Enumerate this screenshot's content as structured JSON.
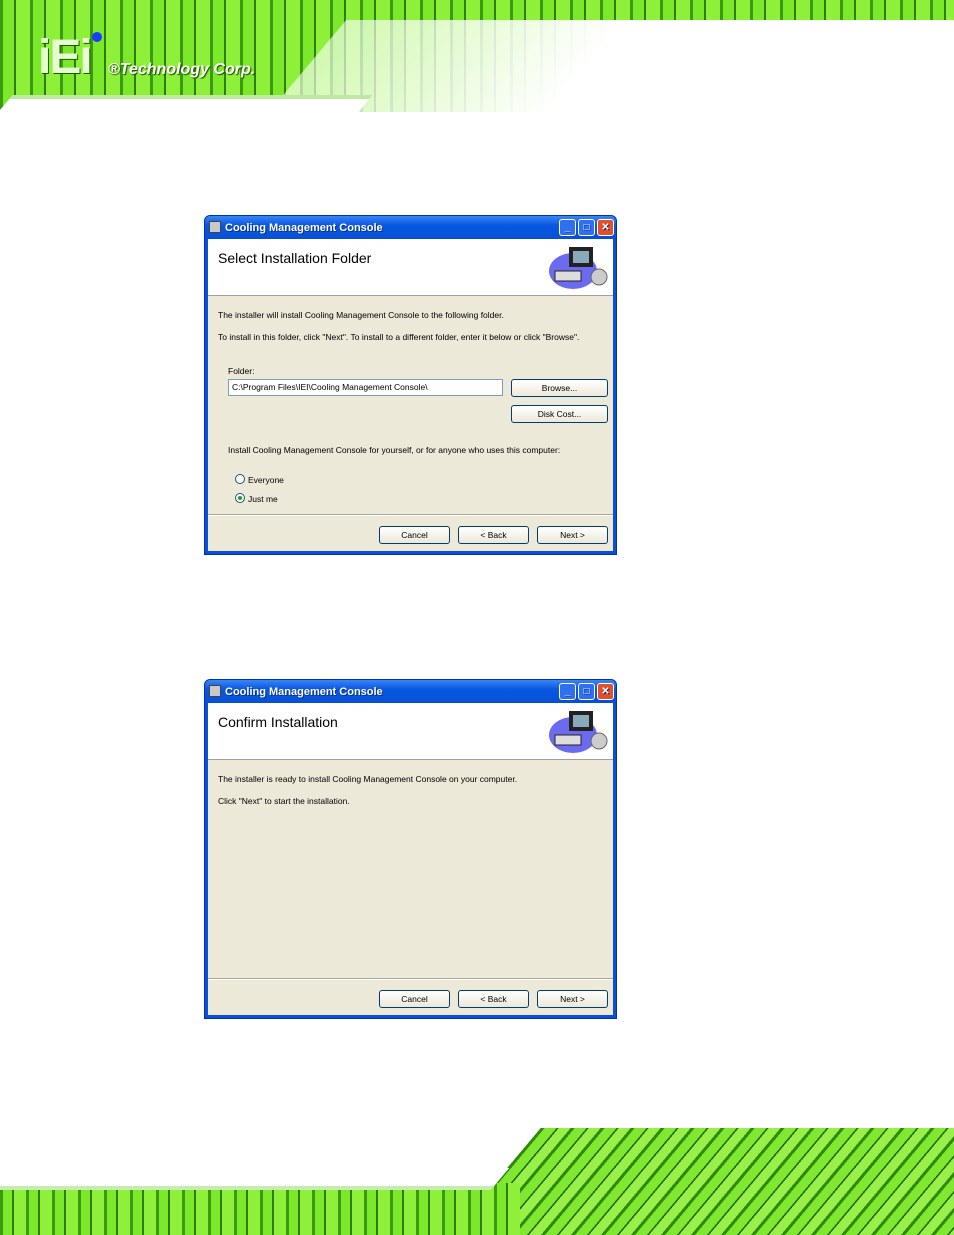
{
  "brand": {
    "logo": "iEi",
    "corp": "®Technology Corp."
  },
  "dialogs": [
    {
      "title": "Cooling Management Console",
      "heading": "Select Installation Folder",
      "line1": "The installer will install Cooling Management Console to the following folder.",
      "line2": "To install in this folder, click \"Next\". To install to a different folder, enter it below or click \"Browse\".",
      "folder_label": "Folder:",
      "folder_value": "C:\\Program Files\\IEI\\Cooling Management Console\\",
      "browse": "Browse...",
      "disk_cost": "Disk Cost...",
      "install_for": "Install Cooling Management Console for yourself, or for anyone who uses this computer:",
      "options": [
        {
          "label": "Everyone",
          "selected": false
        },
        {
          "label": "Just me",
          "selected": true
        }
      ],
      "cancel": "Cancel",
      "back": "< Back",
      "next": "Next >"
    },
    {
      "title": "Cooling Management Console",
      "heading": "Confirm Installation",
      "line1": "The installer is ready to install Cooling Management Console on your computer.",
      "line2": "Click \"Next\" to start the installation.",
      "cancel": "Cancel",
      "back": "< Back",
      "next": "Next >"
    }
  ]
}
